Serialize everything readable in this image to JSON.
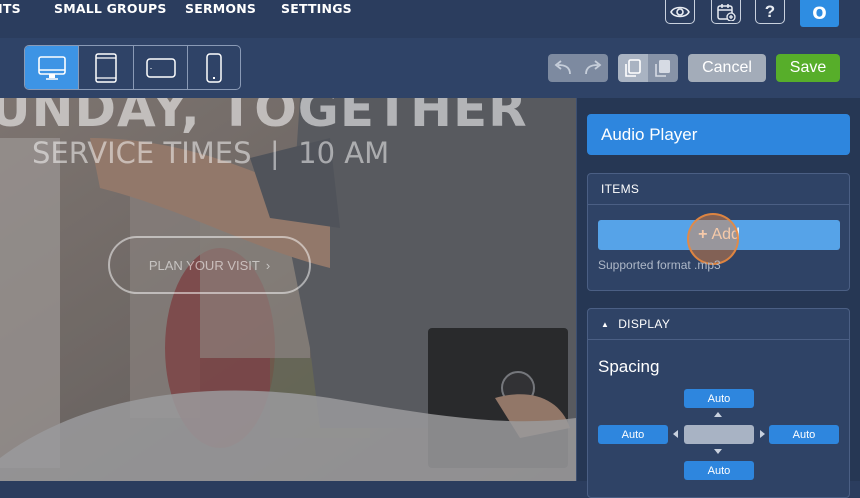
{
  "nav": {
    "items": [
      "ITS",
      "SMALL GROUPS",
      "SERMONS",
      "SETTINGS"
    ],
    "avatar_letter": "O",
    "help_label": "?",
    "icons": [
      "eye-icon",
      "calendar-add-icon",
      "help-icon"
    ]
  },
  "toolbar": {
    "devices": [
      "desktop-icon",
      "tablet-portrait-icon",
      "tablet-landscape-icon",
      "mobile-icon"
    ],
    "active_device": "desktop",
    "cancel_label": "Cancel",
    "save_label": "Save"
  },
  "canvas": {
    "headline": "UNDAY, TOGETHER",
    "service_times": "SERVICE TIMES  |  10 AM",
    "cta_label": "PLAN YOUR VISIT",
    "cta_icon": "chevron-right-icon"
  },
  "panel": {
    "title": "Audio Player",
    "items": {
      "header": "ITEMS",
      "add_label": "Add",
      "hint": "Supported format .mp3"
    },
    "display": {
      "header": "DISPLAY",
      "spacing_label": "Spacing",
      "top": "Auto",
      "left": "Auto",
      "right": "Auto",
      "bottom": "Auto"
    }
  },
  "colors": {
    "nav_bg": "#2b3d5e",
    "accent": "#2e86de",
    "save": "#57ae2a",
    "cancel": "#a3acb9"
  }
}
